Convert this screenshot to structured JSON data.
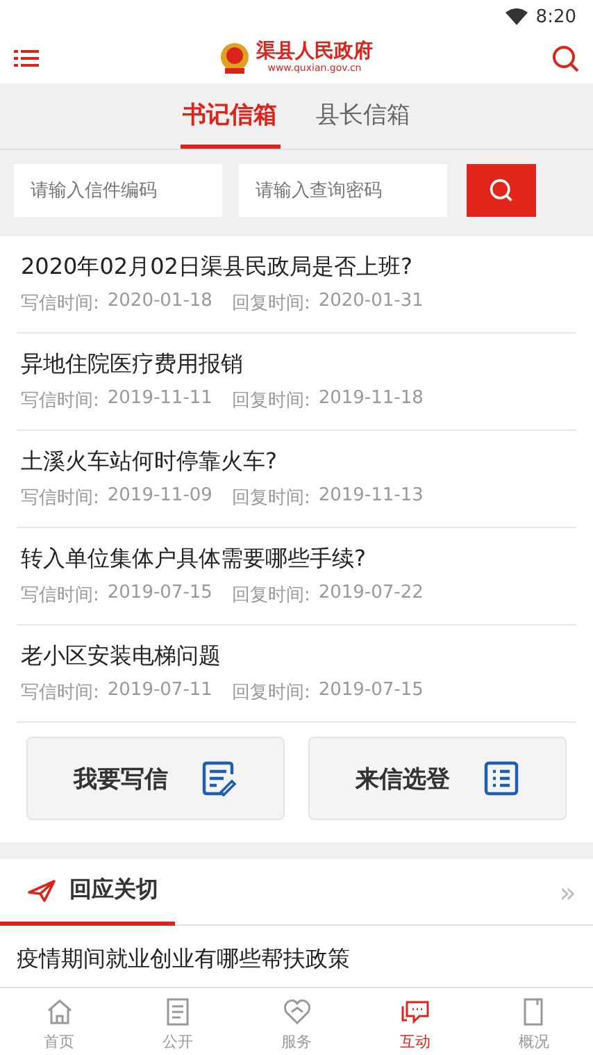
{
  "status_bar": {
    "time": "8:20"
  },
  "header": {
    "title": "渠县人民政府",
    "url": "www.quxian.gov.cn"
  },
  "tabs": [
    {
      "label": "书记信箱",
      "selected": true
    },
    {
      "label": "县长信箱",
      "selected": false
    }
  ],
  "search": {
    "code_placeholder": "请输入信件编码",
    "password_placeholder": "请输入查询密码"
  },
  "letters": [
    {
      "title": "2020年02月02日渠县民政局是否上班?",
      "write_label": "写信时间:",
      "write_date": "2020-01-18",
      "reply_label": "回复时间:",
      "reply_date": "2020-01-31"
    },
    {
      "title": "异地住院医疗费用报销",
      "write_label": "写信时间:",
      "write_date": "2019-11-11",
      "reply_label": "回复时间:",
      "reply_date": "2019-11-18"
    },
    {
      "title": "土溪火车站何时停靠火车?",
      "write_label": "写信时间:",
      "write_date": "2019-11-09",
      "reply_label": "回复时间:",
      "reply_date": "2019-11-13"
    },
    {
      "title": "转入单位集体户具体需要哪些手续?",
      "write_label": "写信时间:",
      "write_date": "2019-07-15",
      "reply_label": "回复时间:",
      "reply_date": "2019-07-22"
    },
    {
      "title": "老小区安装电梯问题",
      "write_label": "写信时间:",
      "write_date": "2019-07-11",
      "reply_label": "回复时间:",
      "reply_date": "2019-07-15"
    }
  ],
  "actions": [
    {
      "label": "我要写信",
      "kind": "write"
    },
    {
      "label": "来信选登",
      "kind": "list"
    }
  ],
  "section": {
    "title": "回应关切",
    "more": "»",
    "items": [
      "疫情期间就业创业有哪些帮扶政策"
    ]
  },
  "nav": [
    {
      "label": "首页",
      "kind": "home",
      "selected": false
    },
    {
      "label": "公开",
      "kind": "doc",
      "selected": false
    },
    {
      "label": "服务",
      "kind": "service",
      "selected": false
    },
    {
      "label": "互动",
      "kind": "chat",
      "selected": true
    },
    {
      "label": "概况",
      "kind": "book",
      "selected": false
    }
  ]
}
